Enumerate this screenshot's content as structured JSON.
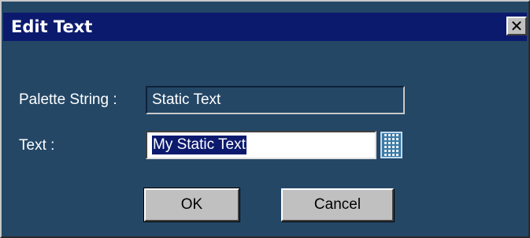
{
  "dialog": {
    "title": "Edit Text",
    "close_symbol": "✕",
    "palette_string_label": "Palette String :",
    "palette_string_value": "Static Text",
    "text_label": "Text :",
    "text_value": "My Static Text",
    "keypad_icon": "keypad-icon",
    "ok_label": "OK",
    "cancel_label": "Cancel"
  },
  "colors": {
    "title_bar": "#0c1a6e",
    "body": "#244766",
    "button_face": "#c0c0c0",
    "selection": "#0c1a6e"
  }
}
